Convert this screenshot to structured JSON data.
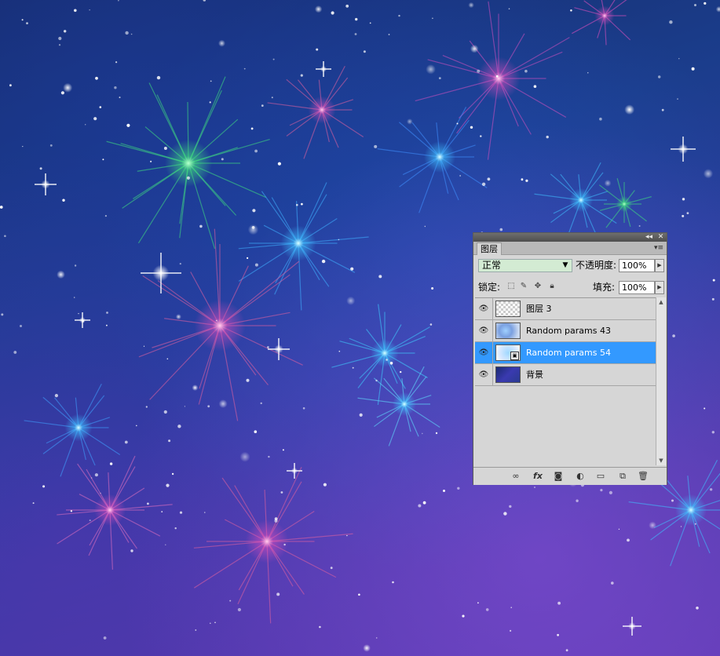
{
  "panel": {
    "tab_label": "图层",
    "collapse_glyph": "◂◂",
    "close_glyph": "✕",
    "menu_glyph": "▾≡",
    "blend_mode": "正常",
    "opacity_label": "不透明度:",
    "opacity_value": "100%",
    "lock_label": "锁定:",
    "fill_label": "填充:",
    "fill_value": "100%",
    "layers": [
      {
        "name": "图层 3",
        "visible": true,
        "selected": false,
        "thumbnail": "transparent"
      },
      {
        "name": "Random params 43",
        "visible": true,
        "selected": false,
        "thumbnail": "stars"
      },
      {
        "name": "Random params 54",
        "visible": true,
        "selected": true,
        "thumbnail": "smart-object"
      },
      {
        "name": "背景",
        "visible": true,
        "selected": false,
        "thumbnail": "background"
      }
    ],
    "bottom_icons": [
      "link-icon",
      "fx-icon",
      "mask-icon",
      "adjustment-icon",
      "folder-icon",
      "new-layer-icon",
      "trash-icon"
    ]
  },
  "colors": {
    "selection": "#3399ff",
    "panel_bg": "#d6d6d6",
    "blend_bg": "#d3ebd3"
  }
}
